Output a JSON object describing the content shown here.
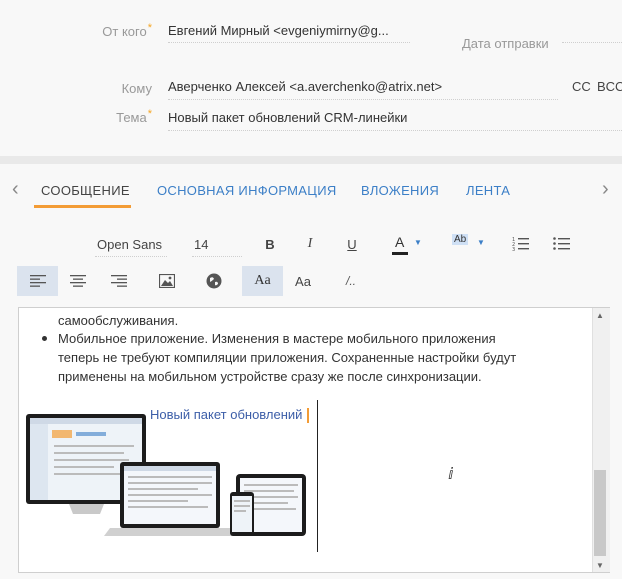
{
  "header": {
    "from_label": "От кого",
    "from_value": "Евгений Мирный <evgeniymirny@g...",
    "send_date_label": "Дата отправки",
    "to_label": "Кому",
    "to_value": "Аверченко Алексей <a.averchenko@atrix.net>",
    "cc_label": "CC",
    "bcc_label": "BCC",
    "subject_label": "Тема",
    "subject_value": "Новый пакет обновлений CRM-линейки",
    "required_mark": "*"
  },
  "tabs": [
    {
      "label": "СООБЩЕНИЕ"
    },
    {
      "label": "ОСНОВНАЯ ИНФОРМАЦИЯ"
    },
    {
      "label": "ВЛОЖЕНИЯ"
    },
    {
      "label": "ЛЕНТА"
    }
  ],
  "toolbar": {
    "font_family": "Open Sans",
    "font_size": "14",
    "bold": "B",
    "italic": "I",
    "underline": "U",
    "font_color": "A",
    "bg_color": "Ab",
    "style_aa_1": "Aa",
    "style_aa_2": "Aa",
    "clear_format": "/.."
  },
  "editor": {
    "partial_line": "самообслуживания.",
    "bullet_lines": [
      "Мобильное приложение. Изменения в мастере мобильного приложения",
      "теперь не требуют компиляции приложения. Сохраненные настройки будут",
      "применены на мобильном устройстве сразу же после синхронизации."
    ],
    "banner_text": "Новый пакет обновлений"
  },
  "colors": {
    "accent_orange": "#f39c36",
    "tab_link": "#3c7fc7",
    "required": "#f5a623",
    "selected_button": "#dbe3ee"
  }
}
